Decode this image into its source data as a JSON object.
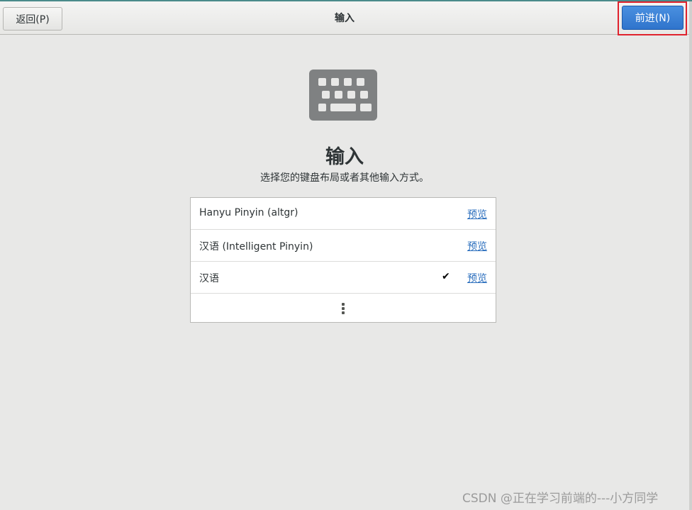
{
  "header": {
    "back_label": "返回(P)",
    "title": "输入",
    "next_label": "前进(N)"
  },
  "main": {
    "icon": "keyboard-icon",
    "heading": "输入",
    "subtitle": "选择您的键盘布局或者其他输入方式。",
    "input_sources": [
      {
        "label": "Hanyu Pinyin (altgr)",
        "preview": "预览",
        "selected": false
      },
      {
        "label": "汉语 (Intelligent Pinyin)",
        "preview": "预览",
        "selected": false
      },
      {
        "label": "汉语",
        "preview": "预览",
        "selected": true
      }
    ],
    "check_glyph": "✔",
    "more_icon": "more-vertical-icon"
  },
  "colors": {
    "accent": "#2f74cc",
    "highlight_border": "#e0222d",
    "link": "#2a6ebd",
    "icon_gray": "#7f8182"
  },
  "watermark": "CSDN @正在学习前端的---小方同学"
}
